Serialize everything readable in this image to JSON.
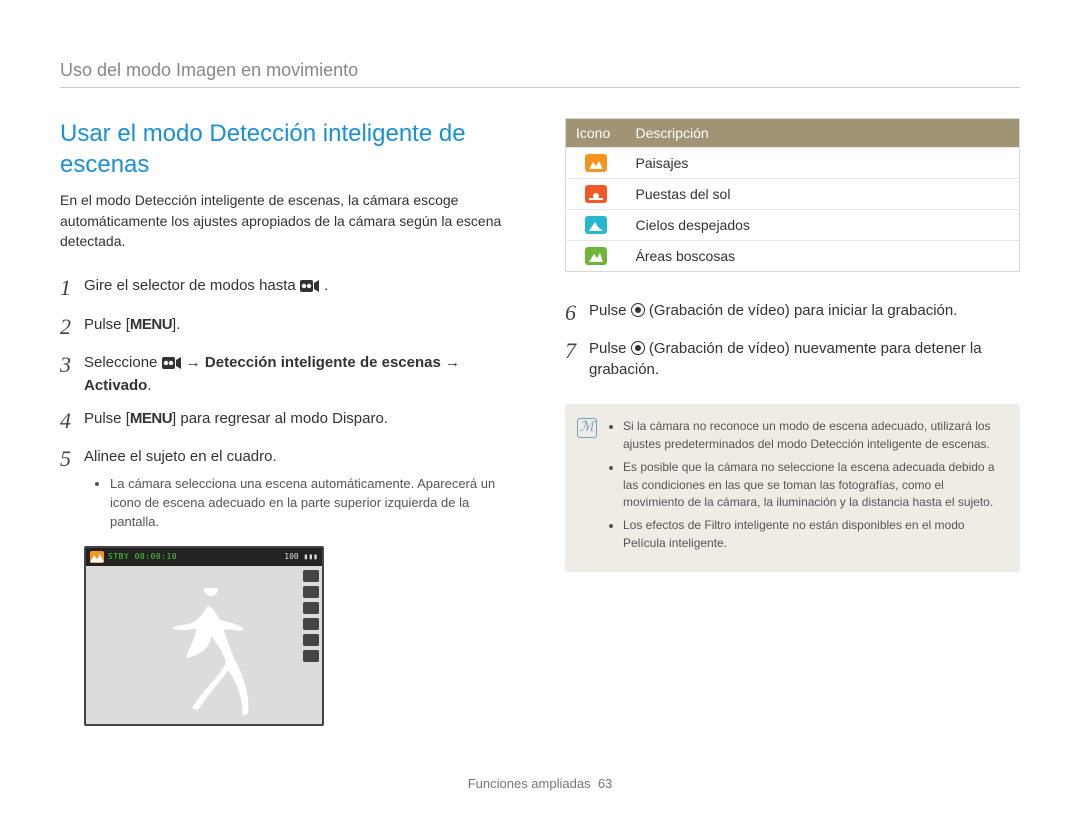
{
  "header": "Uso del modo Imagen en movimiento",
  "title": "Usar el modo Detección inteligente de escenas",
  "intro": "En el modo Detección inteligente de escenas, la cámara escoge automáticamente los ajustes apropiados de la cámara según la escena detectada.",
  "steps": {
    "s1_pre": "Gire el selector de modos hasta ",
    "s1_post": " .",
    "s2_pre": "Pulse [",
    "s2_menu": "MENU",
    "s2_post": "].",
    "s3_pre": "Seleccione ",
    "s3_mid": " → ",
    "s3_bold1": "Detección inteligente de escenas",
    "s3_arrow2": " → ",
    "s3_bold2": "Activado",
    "s3_post": ".",
    "s4_pre": "Pulse [",
    "s4_menu": "MENU",
    "s4_post": "] para regresar al modo Disparo.",
    "s5": "Alinee el sujeto en el cuadro.",
    "s5_bullet": "La cámara selecciona una escena automáticamente. Aparecerá un icono de escena adecuado en la parte superior izquierda de la pantalla.",
    "s6_pre": "Pulse ",
    "s6_post": " (Grabación de vídeo) para iniciar la grabación.",
    "s7_pre": "Pulse ",
    "s7_post": " (Grabación de vídeo) nuevamente para detener la grabación."
  },
  "camera": {
    "stby": "STBY 00:00:10",
    "right": "100"
  },
  "table": {
    "hIcon": "Icono",
    "hDesc": "Descripción",
    "rows": [
      {
        "color": "orange",
        "label": "Paisajes"
      },
      {
        "color": "red",
        "label": "Puestas del sol"
      },
      {
        "color": "cyan",
        "label": "Cielos despejados"
      },
      {
        "color": "green",
        "label": "Áreas boscosas"
      }
    ]
  },
  "notes": [
    "Si la cámara no reconoce un modo de escena adecuado, utilizará los ajustes predeterminados del modo Detección inteligente de escenas.",
    "Es posible que la cámara no seleccione la escena adecuada debido a las condiciones en las que se toman las fotografías, como el movimiento de la cámara, la iluminación y la distancia hasta el sujeto.",
    "Los efectos de Filtro inteligente no están disponibles en el modo Película inteligente."
  ],
  "footer_label": "Funciones ampliadas",
  "footer_page": "63"
}
